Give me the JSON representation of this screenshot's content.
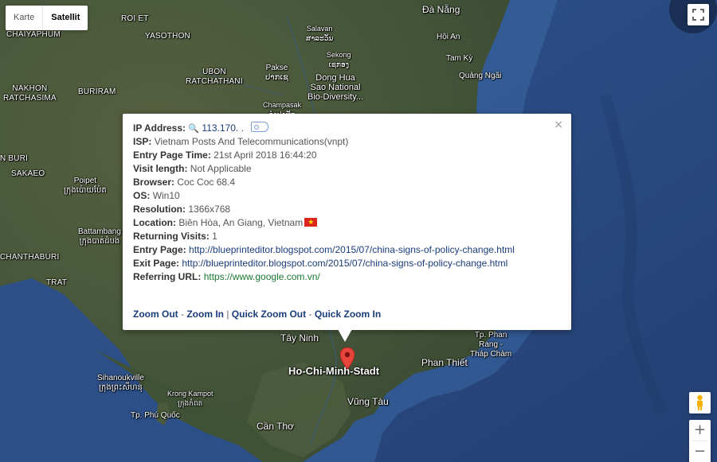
{
  "map": {
    "type_buttons": [
      "Karte",
      "Satellit"
    ],
    "active_type": "Satellit",
    "labels": {
      "chaiyaphum": "CHAIYAPHUM",
      "roi_et": "ROI ET",
      "yasothon": "YASOTHON",
      "salavan": "Salavan\nສາລະວັນ",
      "da_nang": "Đà Nẵng",
      "hoi_an": "Hội An",
      "tam_ky": "Tam Kỳ",
      "quang_ngai": "Quảng Ngãi",
      "ubon": "UBON\nRATCHATHANI",
      "pakse": "Pakse\nປາກເຊ",
      "sekong": "Sekong\nເຊກອງ",
      "dong_hua": "Dong Hua\nSao National\nBio-Diversity...",
      "nakhon": "NAKHON\nRATCHASIMA",
      "buriram": "BURIRAM",
      "champasak": "Champasak\nຈຳປາສັກ",
      "n_buri": "N BURI",
      "sakaeo": "SAKAEO",
      "poipet": "Poipet\nក្រុងប៉ោយប៉ែត",
      "battambang": "Battambang\nក្រុងបាត់ដំបង",
      "chanthaburi": "CHANTHABURI",
      "trat": "TRAT",
      "phan_rang": "Tp. Phan\nRang -\nTháp Chàm",
      "tay_ninh": "Tây Ninh",
      "hcm": "Ho-Chi-Minh-Stadt",
      "phan_thiet": "Phan Thiết",
      "sihanoukville": "Sihanoukville\nក្រុងព្រះសីហនុ",
      "kron_kampot": "Krong Kampot\nក្រុងកំពត",
      "vung_tau": "Vũng Tàu",
      "phu_quoc": "Tp. Phú Quốc",
      "can_tho": "Cần Thơ"
    }
  },
  "info": {
    "ip_label": "IP Address:",
    "ip_value": "113.170.   .",
    "isp_label": "ISP:",
    "isp_value": "Vietnam Posts And Telecommunications(vnpt)",
    "entry_time_label": "Entry Page Time:",
    "entry_time_value": "21st April 2018 16:44:20",
    "visit_length_label": "Visit length:",
    "visit_length_value": "Not Applicable",
    "browser_label": "Browser:",
    "browser_value": "Coc Coc 68.4",
    "os_label": "OS:",
    "os_value": "Win10",
    "resolution_label": "Resolution:",
    "resolution_value": "1366x768",
    "location_label": "Location:",
    "location_value": "Biên Hòa, An Giang, Vietnam",
    "returning_label": "Returning Visits:",
    "returning_value": "1",
    "entry_page_label": "Entry Page:",
    "entry_page_value": "http://blueprinteditor.blogspot.com/2015/07/china-signs-of-policy-change.html",
    "exit_page_label": "Exit Page:",
    "exit_page_value": "http://blueprinteditor.blogspot.com/2015/07/china-signs-of-policy-change.html",
    "referring_label": "Referring URL:",
    "referring_value": "https://www.google.com.vn/",
    "zoom_out": "Zoom Out",
    "zoom_in": "Zoom In",
    "quick_zoom_out": "Quick Zoom Out",
    "quick_zoom_in": "Quick Zoom In",
    "sep_dash": " - ",
    "sep_bar": " | "
  },
  "controls": {
    "zoom_plus": "+",
    "zoom_minus": "−",
    "close": "×"
  },
  "colors": {
    "sea": "#2c4d86",
    "land": "#4d5a3a",
    "link": "#1a3d7a",
    "referrer": "#1c7a32",
    "pin": "#e8453c"
  },
  "icons": [
    "magnifier-icon",
    "tag-icon",
    "vietnam-flag-icon",
    "fullscreen-icon",
    "pegman-icon",
    "map-pin-icon"
  ]
}
